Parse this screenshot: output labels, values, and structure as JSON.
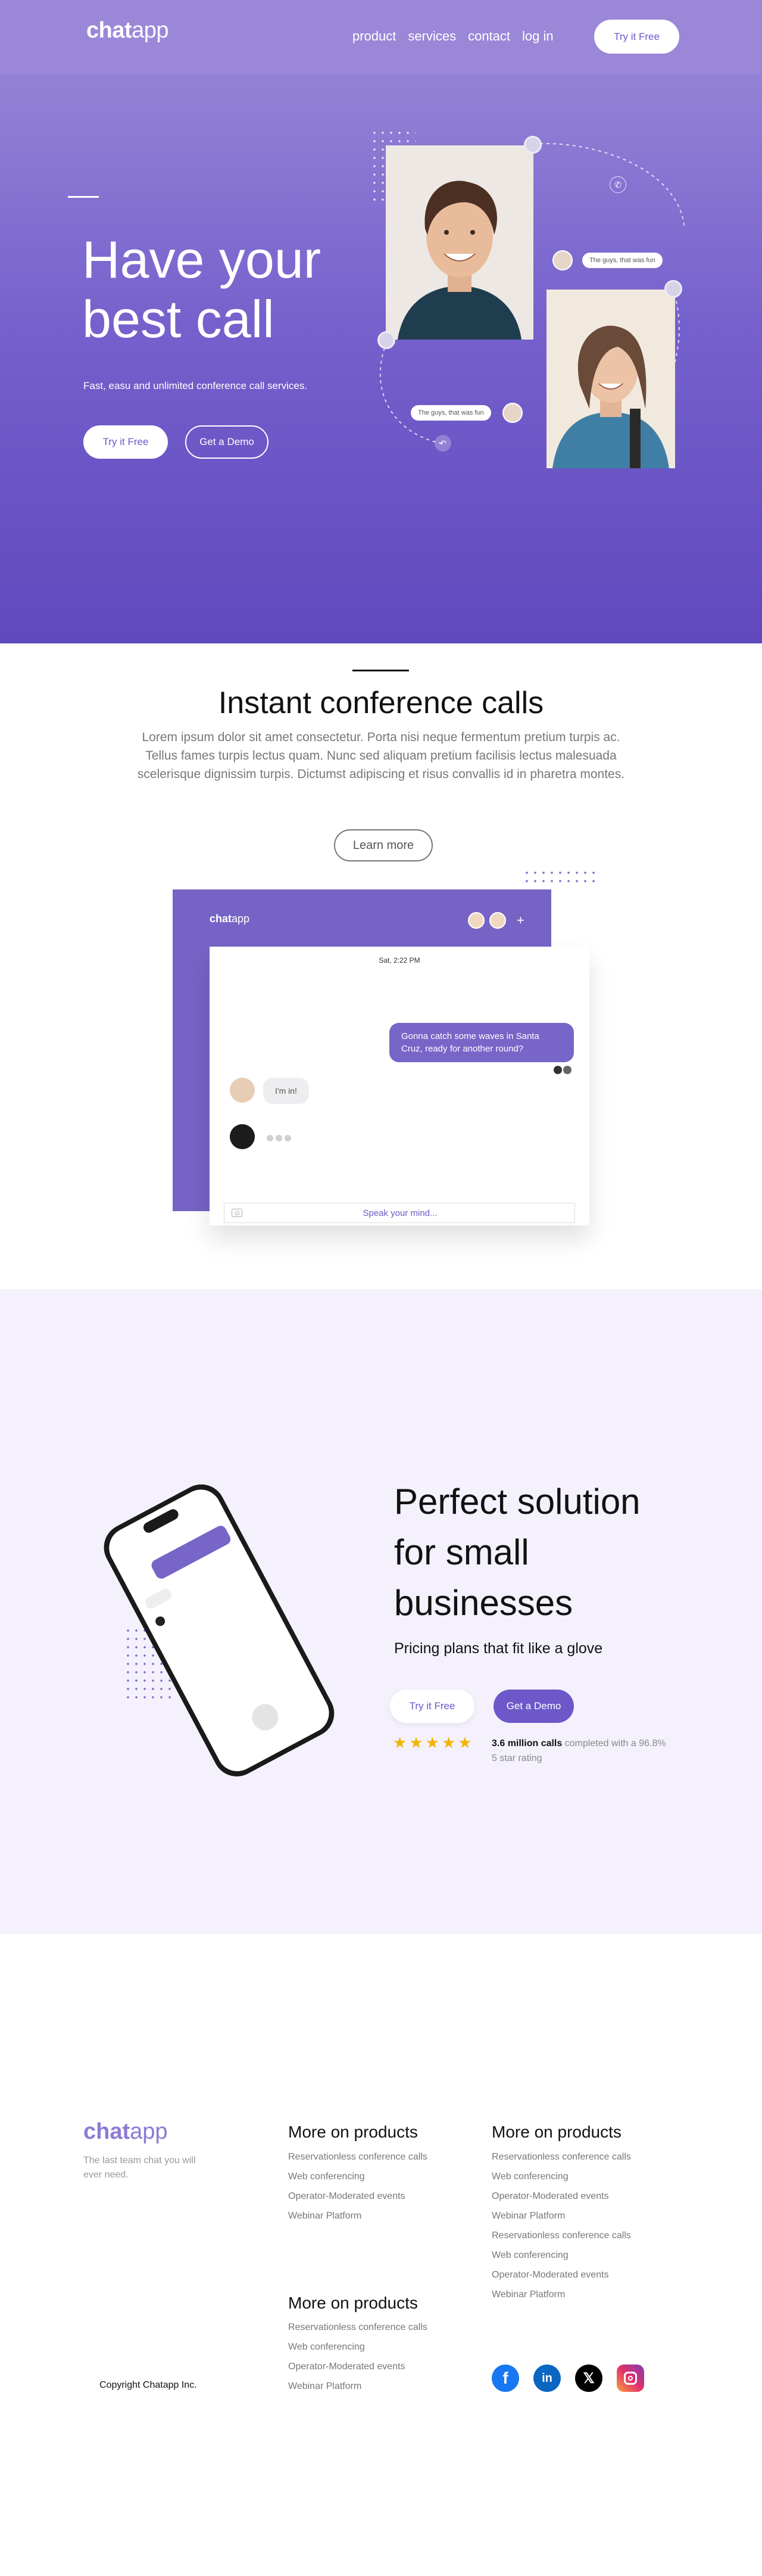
{
  "nav": {
    "logo_bold": "chat",
    "logo_light": "app",
    "links": [
      "product",
      "services",
      "contact",
      "log in"
    ],
    "cta": "Try it Free"
  },
  "hero": {
    "title": "Have your best call",
    "subtitle": "Fast, easu and unlimited conference call services.",
    "cta_primary": "Try it Free",
    "cta_secondary": "Get a Demo",
    "bubble_top": "The guys, that was fun",
    "bubble_bottom": "The guys, that was fun"
  },
  "instant": {
    "title": "Instant conference calls",
    "body": "Lorem ipsum dolor sit amet consectetur. Porta nisi neque fermentum pretium turpis ac. Tellus fames turpis lectus quam. Nunc sed aliquam pretium facilisis lectus malesuada scelerisque dignissim turpis. Dictumst adipiscing et risus convallis id in pharetra montes.",
    "learn_more": "Learn more"
  },
  "chat_app": {
    "logo_bold": "chat",
    "logo_light": "app",
    "plus": "+",
    "date": "Sat, 2:22 PM",
    "msg_out": "Gonna catch some waves in Santa Cruz, ready for another round?",
    "msg_in": "I'm in!",
    "input_placeholder": "Speak your mind..."
  },
  "perfect": {
    "title": "Perfect solution for small businesses",
    "subtitle": "Pricing plans that fit like a glove",
    "cta_primary": "Try it Free",
    "cta_secondary": "Get a Demo",
    "stars": 5,
    "rating_bold": "3.6 million calls",
    "rating_rest": " completed with a 96.8% 5 star rating"
  },
  "footer": {
    "logo_bold": "chat",
    "logo_light": "app",
    "tagline": "The last team chat you will ever need.",
    "col1": {
      "heading": "More on products",
      "items": [
        "Reservationless conference calls",
        "Web conferencing",
        "Operator-Moderated events",
        "Webinar Platform"
      ]
    },
    "col2": {
      "heading": "More on products",
      "items": [
        "Reservationless conference calls",
        "Web conferencing",
        "Operator-Moderated events",
        "Webinar Platform",
        "Reservationless conference calls",
        "Web conferencing",
        "Operator-Moderated events",
        "Webinar Platform"
      ]
    },
    "col3": {
      "heading": "More on products",
      "items": [
        "Reservationless conference calls",
        "Web conferencing",
        "Operator-Moderated events",
        "Webinar Platform"
      ]
    },
    "copyright": "Copyright Chatapp Inc.",
    "social": [
      "facebook-icon",
      "linkedin-icon",
      "x-icon",
      "instagram-icon"
    ]
  },
  "colors": {
    "brand": "#7663c6",
    "hero_top": "#9383d6",
    "hero_bottom": "#5f49bd",
    "star": "#f0b400",
    "section_bg": "#f4f1fc"
  }
}
